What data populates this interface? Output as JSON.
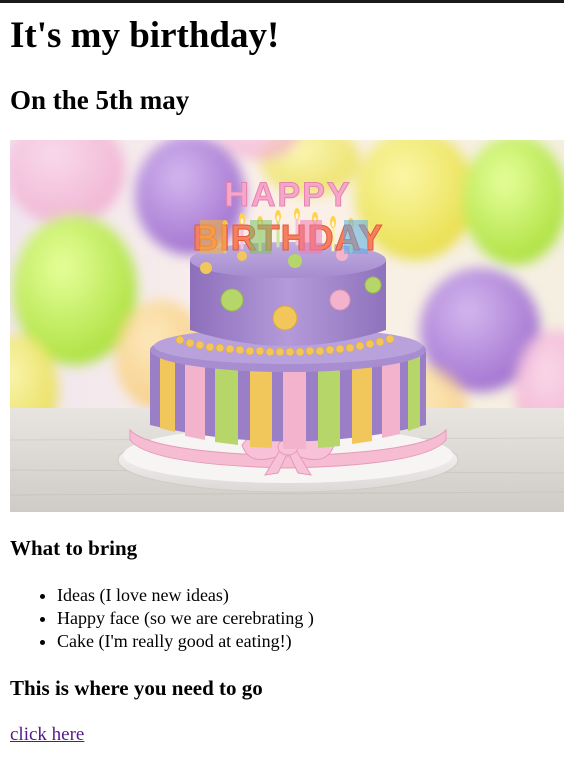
{
  "page": {
    "title": "It's my birthday!",
    "subtitle": "On the 5th may"
  },
  "hero_image": {
    "icon": "birthday-cake-photo",
    "cake_topper": "HAPPY BIRTHDAY",
    "colors": {
      "balloon_purple": "#b58ad8",
      "balloon_green": "#c8ee5a",
      "balloon_yellow": "#f3e860",
      "cake_purple": "#9d7fc4",
      "stripe_yellow": "#f0c95a",
      "stripe_pink": "#f4b2cc",
      "stripe_green": "#b6d66a"
    }
  },
  "bring": {
    "heading": "What to bring",
    "items": [
      "Ideas (I love new ideas)",
      "Happy face (so we are cerebrating )",
      "Cake (I'm really good at eating!)"
    ]
  },
  "directions": {
    "heading": "This is where you need to go",
    "link_label": "click here",
    "link_color": "#551a8b"
  }
}
